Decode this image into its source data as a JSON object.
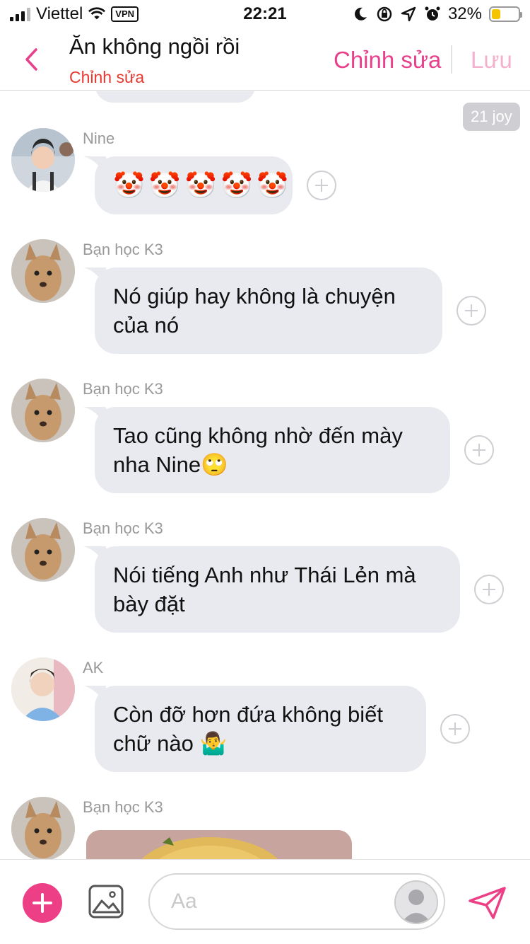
{
  "status_bar": {
    "carrier": "Viettel",
    "vpn": "VPN",
    "time": "22:21",
    "battery": "32%",
    "battery_level": 0.32
  },
  "header": {
    "title": "Ăn không ngồi rồi",
    "subtitle": "Chỉnh sửa",
    "edit_label": "Chỉnh sửa",
    "save_label": "Lưu"
  },
  "chat": {
    "reaction_count": "21 joy",
    "messages": [
      {
        "sender": "Nine",
        "text": "🤡🤡🤡🤡🤡",
        "emojis": [
          "🤡",
          "🤡",
          "🤡",
          "🤡",
          "🤡"
        ]
      },
      {
        "sender": "Bạn học K3",
        "text": "Nó giúp hay không là chuyện của nó"
      },
      {
        "sender": "Bạn học K3",
        "text": "Tao cũng không nhờ đến mày nha Nine🙄"
      },
      {
        "sender": "Bạn học K3",
        "text": "Nói tiếng Anh như Thái Lẻn mà bày đặt"
      },
      {
        "sender": "AK",
        "text": "Còn đỡ hơn đứa không biết chữ nào 🤷‍♂️"
      },
      {
        "sender": "Bạn học K3",
        "text": ""
      }
    ]
  },
  "composer": {
    "placeholder": "Aa"
  },
  "colors": {
    "accent": "#ec3f86",
    "subtitle_red": "#e8392f",
    "bubble_bg": "#e9eaef"
  }
}
